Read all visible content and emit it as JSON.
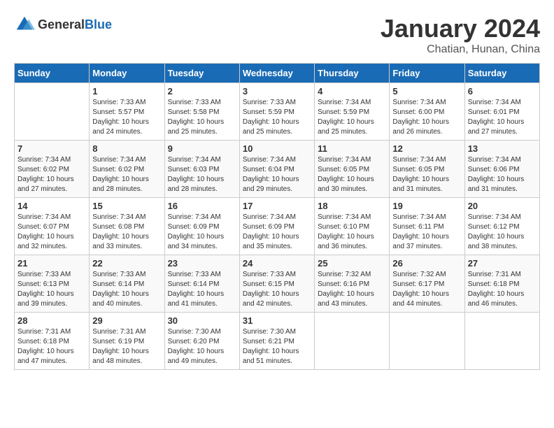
{
  "header": {
    "logo_general": "General",
    "logo_blue": "Blue",
    "month": "January 2024",
    "location": "Chatian, Hunan, China"
  },
  "days_of_week": [
    "Sunday",
    "Monday",
    "Tuesday",
    "Wednesday",
    "Thursday",
    "Friday",
    "Saturday"
  ],
  "weeks": [
    [
      {
        "day": "",
        "sunrise": "",
        "sunset": "",
        "daylight": ""
      },
      {
        "day": "1",
        "sunrise": "Sunrise: 7:33 AM",
        "sunset": "Sunset: 5:57 PM",
        "daylight": "Daylight: 10 hours and 24 minutes."
      },
      {
        "day": "2",
        "sunrise": "Sunrise: 7:33 AM",
        "sunset": "Sunset: 5:58 PM",
        "daylight": "Daylight: 10 hours and 25 minutes."
      },
      {
        "day": "3",
        "sunrise": "Sunrise: 7:33 AM",
        "sunset": "Sunset: 5:59 PM",
        "daylight": "Daylight: 10 hours and 25 minutes."
      },
      {
        "day": "4",
        "sunrise": "Sunrise: 7:34 AM",
        "sunset": "Sunset: 5:59 PM",
        "daylight": "Daylight: 10 hours and 25 minutes."
      },
      {
        "day": "5",
        "sunrise": "Sunrise: 7:34 AM",
        "sunset": "Sunset: 6:00 PM",
        "daylight": "Daylight: 10 hours and 26 minutes."
      },
      {
        "day": "6",
        "sunrise": "Sunrise: 7:34 AM",
        "sunset": "Sunset: 6:01 PM",
        "daylight": "Daylight: 10 hours and 27 minutes."
      }
    ],
    [
      {
        "day": "7",
        "sunrise": "Sunrise: 7:34 AM",
        "sunset": "Sunset: 6:02 PM",
        "daylight": "Daylight: 10 hours and 27 minutes."
      },
      {
        "day": "8",
        "sunrise": "Sunrise: 7:34 AM",
        "sunset": "Sunset: 6:02 PM",
        "daylight": "Daylight: 10 hours and 28 minutes."
      },
      {
        "day": "9",
        "sunrise": "Sunrise: 7:34 AM",
        "sunset": "Sunset: 6:03 PM",
        "daylight": "Daylight: 10 hours and 28 minutes."
      },
      {
        "day": "10",
        "sunrise": "Sunrise: 7:34 AM",
        "sunset": "Sunset: 6:04 PM",
        "daylight": "Daylight: 10 hours and 29 minutes."
      },
      {
        "day": "11",
        "sunrise": "Sunrise: 7:34 AM",
        "sunset": "Sunset: 6:05 PM",
        "daylight": "Daylight: 10 hours and 30 minutes."
      },
      {
        "day": "12",
        "sunrise": "Sunrise: 7:34 AM",
        "sunset": "Sunset: 6:05 PM",
        "daylight": "Daylight: 10 hours and 31 minutes."
      },
      {
        "day": "13",
        "sunrise": "Sunrise: 7:34 AM",
        "sunset": "Sunset: 6:06 PM",
        "daylight": "Daylight: 10 hours and 31 minutes."
      }
    ],
    [
      {
        "day": "14",
        "sunrise": "Sunrise: 7:34 AM",
        "sunset": "Sunset: 6:07 PM",
        "daylight": "Daylight: 10 hours and 32 minutes."
      },
      {
        "day": "15",
        "sunrise": "Sunrise: 7:34 AM",
        "sunset": "Sunset: 6:08 PM",
        "daylight": "Daylight: 10 hours and 33 minutes."
      },
      {
        "day": "16",
        "sunrise": "Sunrise: 7:34 AM",
        "sunset": "Sunset: 6:09 PM",
        "daylight": "Daylight: 10 hours and 34 minutes."
      },
      {
        "day": "17",
        "sunrise": "Sunrise: 7:34 AM",
        "sunset": "Sunset: 6:09 PM",
        "daylight": "Daylight: 10 hours and 35 minutes."
      },
      {
        "day": "18",
        "sunrise": "Sunrise: 7:34 AM",
        "sunset": "Sunset: 6:10 PM",
        "daylight": "Daylight: 10 hours and 36 minutes."
      },
      {
        "day": "19",
        "sunrise": "Sunrise: 7:34 AM",
        "sunset": "Sunset: 6:11 PM",
        "daylight": "Daylight: 10 hours and 37 minutes."
      },
      {
        "day": "20",
        "sunrise": "Sunrise: 7:34 AM",
        "sunset": "Sunset: 6:12 PM",
        "daylight": "Daylight: 10 hours and 38 minutes."
      }
    ],
    [
      {
        "day": "21",
        "sunrise": "Sunrise: 7:33 AM",
        "sunset": "Sunset: 6:13 PM",
        "daylight": "Daylight: 10 hours and 39 minutes."
      },
      {
        "day": "22",
        "sunrise": "Sunrise: 7:33 AM",
        "sunset": "Sunset: 6:14 PM",
        "daylight": "Daylight: 10 hours and 40 minutes."
      },
      {
        "day": "23",
        "sunrise": "Sunrise: 7:33 AM",
        "sunset": "Sunset: 6:14 PM",
        "daylight": "Daylight: 10 hours and 41 minutes."
      },
      {
        "day": "24",
        "sunrise": "Sunrise: 7:33 AM",
        "sunset": "Sunset: 6:15 PM",
        "daylight": "Daylight: 10 hours and 42 minutes."
      },
      {
        "day": "25",
        "sunrise": "Sunrise: 7:32 AM",
        "sunset": "Sunset: 6:16 PM",
        "daylight": "Daylight: 10 hours and 43 minutes."
      },
      {
        "day": "26",
        "sunrise": "Sunrise: 7:32 AM",
        "sunset": "Sunset: 6:17 PM",
        "daylight": "Daylight: 10 hours and 44 minutes."
      },
      {
        "day": "27",
        "sunrise": "Sunrise: 7:31 AM",
        "sunset": "Sunset: 6:18 PM",
        "daylight": "Daylight: 10 hours and 46 minutes."
      }
    ],
    [
      {
        "day": "28",
        "sunrise": "Sunrise: 7:31 AM",
        "sunset": "Sunset: 6:18 PM",
        "daylight": "Daylight: 10 hours and 47 minutes."
      },
      {
        "day": "29",
        "sunrise": "Sunrise: 7:31 AM",
        "sunset": "Sunset: 6:19 PM",
        "daylight": "Daylight: 10 hours and 48 minutes."
      },
      {
        "day": "30",
        "sunrise": "Sunrise: 7:30 AM",
        "sunset": "Sunset: 6:20 PM",
        "daylight": "Daylight: 10 hours and 49 minutes."
      },
      {
        "day": "31",
        "sunrise": "Sunrise: 7:30 AM",
        "sunset": "Sunset: 6:21 PM",
        "daylight": "Daylight: 10 hours and 51 minutes."
      },
      {
        "day": "",
        "sunrise": "",
        "sunset": "",
        "daylight": ""
      },
      {
        "day": "",
        "sunrise": "",
        "sunset": "",
        "daylight": ""
      },
      {
        "day": "",
        "sunrise": "",
        "sunset": "",
        "daylight": ""
      }
    ]
  ]
}
